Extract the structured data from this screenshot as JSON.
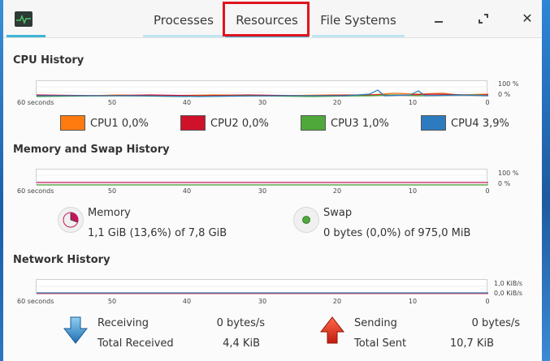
{
  "tabs": [
    {
      "label": "Processes"
    },
    {
      "label": "Resources"
    },
    {
      "label": "File Systems"
    }
  ],
  "window_controls": {
    "minimize": "minimize-icon",
    "maximize": "maximize-icon",
    "close": "✕"
  },
  "cpu": {
    "title": "CPU History",
    "percent_top": "100 %",
    "percent_bottom": "0 %",
    "ticks": [
      "60 seconds",
      "50",
      "40",
      "30",
      "20",
      "10",
      "0"
    ],
    "legend": [
      {
        "label": "CPU1",
        "value": "0,0%",
        "color": "#ff7b0f"
      },
      {
        "label": "CPU2",
        "value": "0,0%",
        "color": "#d0112a"
      },
      {
        "label": "CPU3",
        "value": "1,0%",
        "color": "#4ea83a"
      },
      {
        "label": "CPU4",
        "value": "3,9%",
        "color": "#2d7bbf"
      }
    ]
  },
  "memory": {
    "title": "Memory and Swap History",
    "percent_top": "100 %",
    "percent_bottom": "0 %",
    "ticks": [
      "60 seconds",
      "50",
      "40",
      "30",
      "20",
      "10",
      "0"
    ],
    "memory_label": "Memory",
    "memory_value": "1,1 GiB (13,6%) of 7,8 GiB",
    "memory_color": "#c2175b",
    "swap_label": "Swap",
    "swap_value": "0 bytes (0,0%) of 975,0 MiB",
    "swap_color": "#4ea83a"
  },
  "network": {
    "title": "Network History",
    "rate_top": "1,0 KiB/s",
    "rate_bottom": "0,0 KiB/s",
    "ticks": [
      "60 seconds",
      "50",
      "40",
      "30",
      "20",
      "10",
      "0"
    ],
    "receiving_label": "Receiving",
    "receiving_value": "0 bytes/s",
    "total_received_label": "Total Received",
    "total_received_value": "4,4 KiB",
    "sending_label": "Sending",
    "sending_value": "0 bytes/s",
    "total_sent_label": "Total Sent",
    "total_sent_value": "10,7 KiB"
  }
}
